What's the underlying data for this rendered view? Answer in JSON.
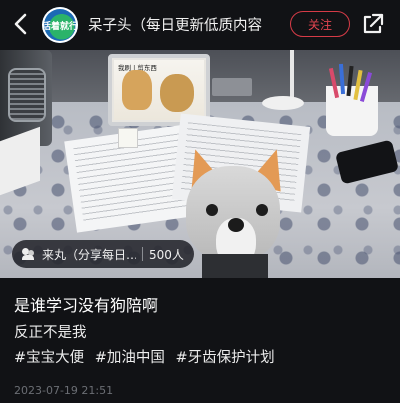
{
  "header": {
    "avatar_text": "活着就行",
    "username": "呆子头（每日更新低质内容",
    "follow_label": "关注",
    "back_icon": "back-arrow-icon",
    "share_icon": "share-icon"
  },
  "photo": {
    "tablet_text": "我刷 | 剪东西"
  },
  "pill": {
    "group_name": "来丸（分享每日…",
    "member_count": "500人"
  },
  "post": {
    "title": "是谁学习没有狗陪啊",
    "body": "反正不是我",
    "tags": [
      "#宝宝大便",
      "#加油中国",
      "#牙齿保护计划"
    ],
    "date": "2023-07-19 21:51"
  },
  "colors": {
    "background": "#111215",
    "follow_accent": "#e2444f",
    "date_text": "#6b6e74"
  }
}
